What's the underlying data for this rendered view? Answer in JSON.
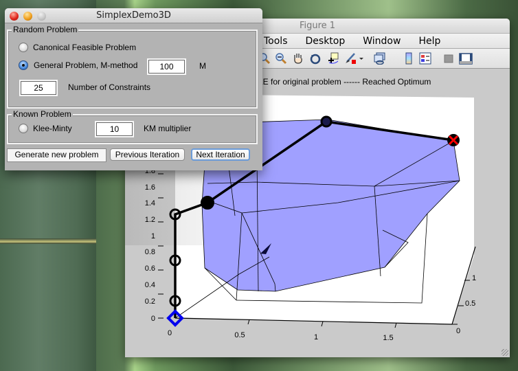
{
  "desktop": {
    "background": "bamboo"
  },
  "figure_window": {
    "title": "Figure 1",
    "menu": [
      "Tools",
      "Desktop",
      "Window",
      "Help"
    ],
    "toolbar_icons": [
      "zoom-in-icon",
      "zoom-out-icon",
      "pan-hand-icon",
      "rotate-3d-icon",
      "data-cursor-icon",
      "brush-icon",
      "brush-dropdown-icon",
      "link-plot-icon",
      "colorbar-icon",
      "legend-icon",
      "hide-plot-tools-icon",
      "show-plot-tools-icon"
    ],
    "status_text": "BLE for original problem ------ Reached Optimum"
  },
  "dialog": {
    "title": "SimplexDemo3D",
    "random_panel": {
      "legend": "Random Problem",
      "option_canonical": "Canonical Feasible Problem",
      "option_general": "General Problem, M-method",
      "selected": "general",
      "m_value": "100",
      "m_label": "M",
      "constraints_value": "25",
      "constraints_label": "Number of Constraints"
    },
    "known_panel": {
      "legend": "Known Problem",
      "option_klee": "Klee-Minty",
      "km_value": "10",
      "km_label": "KM multiplier"
    },
    "buttons": {
      "generate": "Generate new problem",
      "previous": "Previous Iteration",
      "next": "Next Iteration"
    }
  },
  "chart_data": {
    "type": "3d-polytope-path",
    "title": "",
    "z_ticks": [
      "0",
      "0.2",
      "0.4",
      "0.6",
      "0.8",
      "1",
      "1.2",
      "1.4",
      "1.6",
      "1.8"
    ],
    "x_ticks": [
      "0",
      "0.5",
      "1",
      "1.5"
    ],
    "y_ticks": [
      "0",
      "0.5",
      "1"
    ],
    "zlim": [
      0,
      1.8
    ],
    "xlim": [
      0,
      1.8
    ],
    "ylim": [
      0,
      1.2
    ],
    "polytope_color": "#a0a0ff",
    "path_vertices": [
      {
        "label": "start",
        "z": 0,
        "marker": "blue-diamond"
      },
      {
        "z": 0.2,
        "marker": "circle"
      },
      {
        "z": 0.7,
        "marker": "circle"
      },
      {
        "z": 1.27,
        "marker": "circle"
      },
      {
        "z": 1.4,
        "marker": "circle-filled"
      },
      {
        "z": 2.0,
        "marker": "circle"
      },
      {
        "label": "optimum",
        "z": 1.95,
        "marker": "red-x"
      }
    ]
  }
}
